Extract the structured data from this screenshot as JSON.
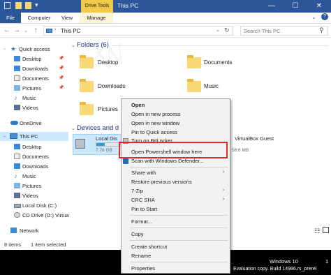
{
  "window": {
    "title": "This PC",
    "context_tab": "Drive Tools",
    "controls": [
      "—",
      "☐",
      "✕"
    ]
  },
  "ribbon": {
    "tabs": [
      "File",
      "Computer",
      "View",
      "Manage"
    ]
  },
  "address": {
    "path": "This PC",
    "search_placeholder": "Search This PC"
  },
  "nav": {
    "quick_access": "Quick access",
    "items": [
      {
        "label": "Desktop"
      },
      {
        "label": "Downloads"
      },
      {
        "label": "Documents"
      },
      {
        "label": "Pictures"
      },
      {
        "label": "Music"
      },
      {
        "label": "Videos"
      }
    ],
    "onedrive": "OneDrive",
    "this_pc": "This PC",
    "pc_items": [
      {
        "label": "Desktop"
      },
      {
        "label": "Documents"
      },
      {
        "label": "Downloads"
      },
      {
        "label": "Music"
      },
      {
        "label": "Pictures"
      },
      {
        "label": "Videos"
      },
      {
        "label": "Local Disk (C:)"
      },
      {
        "label": "CD Drive (D:) Virtua"
      }
    ],
    "network": "Network"
  },
  "folders": {
    "heading": "Folders (6)",
    "items": [
      "Desktop",
      "Documents",
      "Downloads",
      "Music",
      "Pictures"
    ]
  },
  "devices": {
    "heading": "Devices and d",
    "local_disk_name": "Local Dis",
    "local_disk_free": "7.78 GB",
    "local_disk_used_fraction": 0.35,
    "cd_name": "VirtualBox Guest",
    "cd_free": "56.6 MB"
  },
  "status": {
    "items_count": "8 items",
    "selected": "1 item selected"
  },
  "taskbar": {
    "line1": "Windows 10",
    "line2": "Evaluation copy. Build 14986.rs_prerel",
    "clock": "1"
  },
  "context_menu": {
    "items": [
      {
        "label": "Open",
        "bold": true
      },
      {
        "label": "Open in new process"
      },
      {
        "label": "Open in new window"
      },
      {
        "label": "Pin to Quick access"
      },
      {
        "label": "Turn on BitLocker"
      },
      {
        "label": "Open Powershell window here"
      },
      {
        "label": "Scan with Windows Defender..."
      },
      {
        "label": "Share with"
      },
      {
        "label": "Restore previous versions"
      },
      {
        "label": "7-Zip"
      },
      {
        "label": "CRC SHA"
      },
      {
        "label": "Pin to Start"
      },
      {
        "label": "Format..."
      },
      {
        "label": "Copy"
      },
      {
        "label": "Create shortcut"
      },
      {
        "label": "Rename"
      },
      {
        "label": "Properties"
      }
    ]
  },
  "colors": {
    "titlebar": "#2b579a",
    "drive_tools": "#f3c94a",
    "selection": "#cce8ff",
    "highlight_box": "#e8252b"
  }
}
